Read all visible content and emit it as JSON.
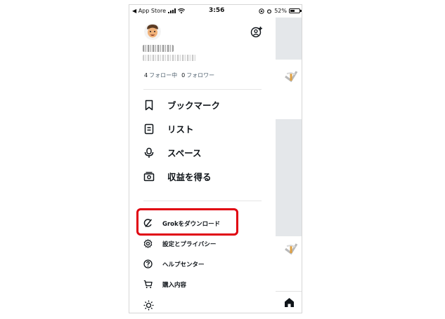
{
  "status_bar": {
    "back_label": "◀ App Store",
    "time": "3:56",
    "battery": "52%"
  },
  "profile": {
    "following_count": "4",
    "following_label": "フォロー中",
    "followers_count": "0",
    "followers_label": "フォロワー"
  },
  "menu": {
    "bookmarks": "ブックマーク",
    "lists": "リスト",
    "spaces": "スペース",
    "monetization": "収益を得る",
    "grok": "Grokをダウンロード",
    "settings": "設定とプライバシー",
    "help": "ヘルプセンター",
    "purchases": "購入内容"
  },
  "colors": {
    "highlight": "#e0000f",
    "muted_text": "#536471",
    "feed_background": "#e4e7ea"
  },
  "icons": [
    "bookmark-icon",
    "list-icon",
    "spaces-icon",
    "monetization-icon",
    "grok-icon",
    "settings-gear-icon",
    "help-icon",
    "cart-icon",
    "brightness-icon",
    "add-account-icon",
    "home-icon"
  ]
}
